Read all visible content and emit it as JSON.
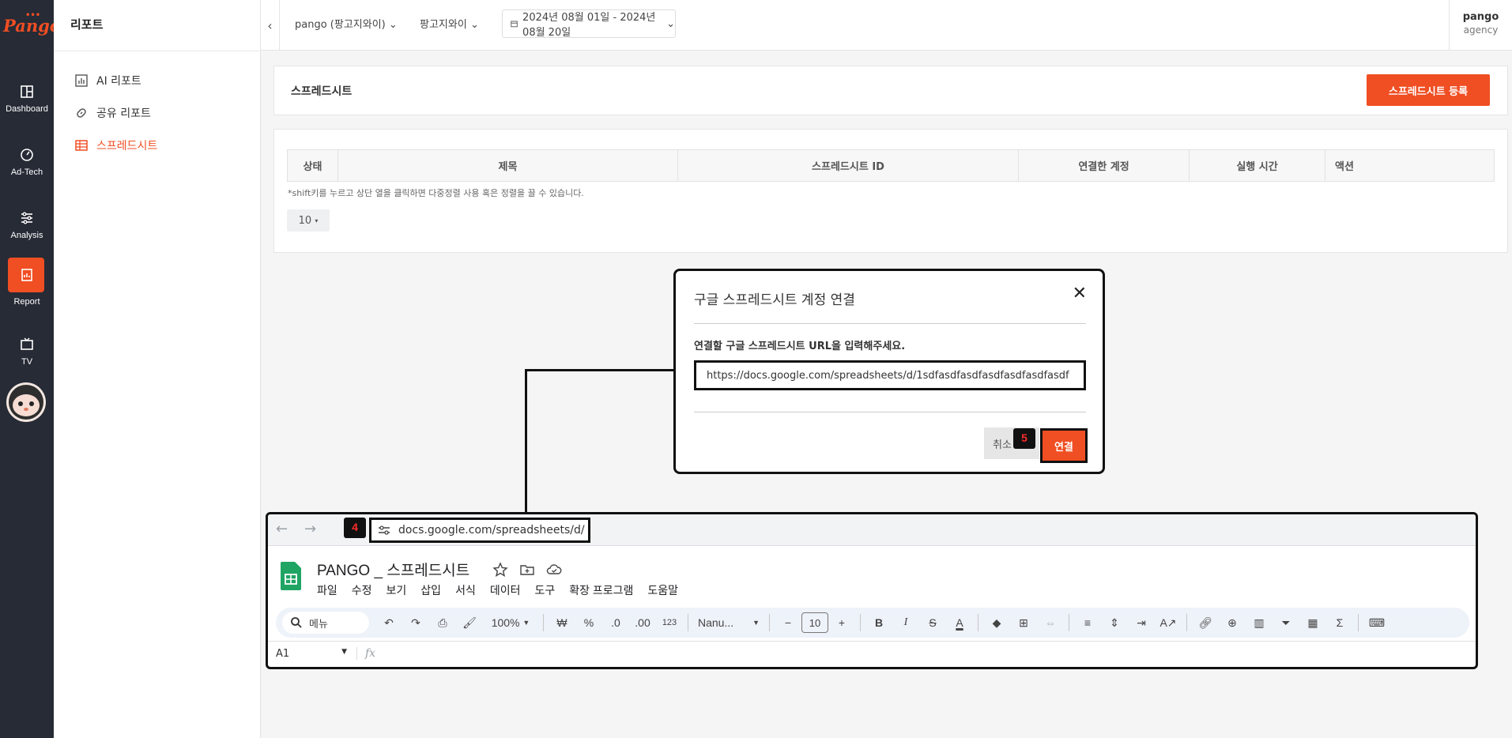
{
  "rail": {
    "logo": "Pango",
    "logo_dots": "•••",
    "items": [
      {
        "label": "Dashboard",
        "icon": "layout-icon"
      },
      {
        "label": "Ad-Tech",
        "icon": "gauge-icon"
      },
      {
        "label": "Analysis",
        "icon": "sliders-icon"
      },
      {
        "label": "Report",
        "icon": "report-icon"
      },
      {
        "label": "TV",
        "icon": "tv-icon"
      }
    ],
    "active_color": "#f04e23"
  },
  "subnav": {
    "title": "리포트",
    "items": [
      {
        "label": "AI 리포트",
        "icon": "bar-chart-icon"
      },
      {
        "label": "공유 리포트",
        "icon": "link-icon"
      },
      {
        "label": "스프레드시트",
        "icon": "table-icon"
      }
    ]
  },
  "header": {
    "account_select": "pango (팡고지와이)",
    "brand_select": "팡고지와이",
    "date_range": "2024년 08월 01일 - 2024년 08월 20일",
    "user_name": "pango",
    "user_role": "agency"
  },
  "page": {
    "title": "스프레드시트",
    "register_button": "스프레드시트 등록",
    "columns": [
      "상태",
      "제목",
      "스프레드시트 ID",
      "연결한 계정",
      "실행 시간",
      "액션"
    ],
    "hint": "*shift키를 누르고 상단 열을 클릭하면 다중정렬 사용 혹은 정렬을 끌 수 있습니다.",
    "page_size": "10"
  },
  "modal": {
    "title": "구글 스프레드시트 계정 연결",
    "label": "연결할 구글 스프레드시트 URL을 입력해주세요.",
    "url_value": "https://docs.google.com/spreadsheets/d/1sdfasdfasdfasdfasdfasdfasdf",
    "cancel": "취소",
    "connect": "연결",
    "step": "5"
  },
  "browser": {
    "step": "4",
    "url": "docs.google.com/spreadsheets/d/",
    "doc_title": "PANGO _ 스프레드시트",
    "menus": [
      "파일",
      "수정",
      "보기",
      "삽입",
      "서식",
      "데이터",
      "도구",
      "확장 프로그램",
      "도움말"
    ],
    "search_label": "메뉴",
    "zoom": "100%",
    "currency": "₩",
    "percent": "%",
    "dec_dec": ".0",
    "dec_inc": ".00",
    "number_format": "123",
    "font": "Nanu...",
    "font_size": "10",
    "cell_ref": "A1",
    "fx": "fx"
  }
}
